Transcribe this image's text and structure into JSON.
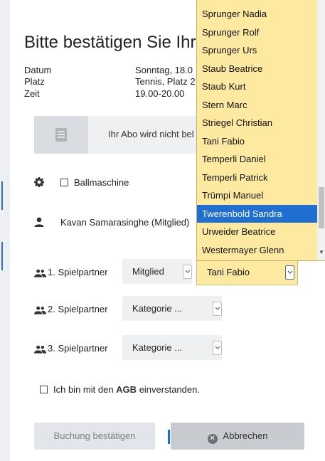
{
  "modal": {
    "title": "Bitte bestätigen Sie Ihre",
    "info": [
      {
        "label": "Datum",
        "value": "Sonntag, 18.0"
      },
      {
        "label": "Platz",
        "value": "Tennis, Platz 2"
      },
      {
        "label": "Zeit",
        "value": "19.00-20.00"
      }
    ],
    "abo_text": "Ihr Abo wird nicht bel",
    "ballmaschine_label": "Ballmaschine",
    "member_label": "Kavan Samarasinghe (Mitglied)",
    "partners": [
      {
        "label": "1. Spielpartner",
        "category": "Mitglied",
        "player": "Tani Fabio"
      },
      {
        "label": "2. Spielpartner",
        "category": "Kategorie ..."
      },
      {
        "label": "3. Spielpartner",
        "category": "Kategorie ..."
      }
    ],
    "agb": {
      "prefix": "Ich bin mit den",
      "link": "AGB",
      "suffix": "einverstanden."
    },
    "buttons": {
      "confirm": "Buchung bestätigen",
      "cancel": "Abbrechen"
    }
  },
  "dropdown": {
    "items": [
      "Sprunger Nadia",
      "Sprunger Rolf",
      "Sprunger Urs",
      "Staub Beatrice",
      "Staub Kurt",
      "Stern Marc",
      "Striegel Christian",
      "Tani Fabio",
      "Temperli Daniel",
      "Temperli Patrick",
      "Trümpi Manuel",
      "Twerenbold Sandra",
      "Urweider Beatrice",
      "Westermayer Glenn"
    ],
    "highlighted": "Twerenbold Sandra"
  },
  "colors": {
    "dropdown_bg": "#fde9a0",
    "highlight": "#1f6fd1",
    "agb_link": "#333333"
  }
}
